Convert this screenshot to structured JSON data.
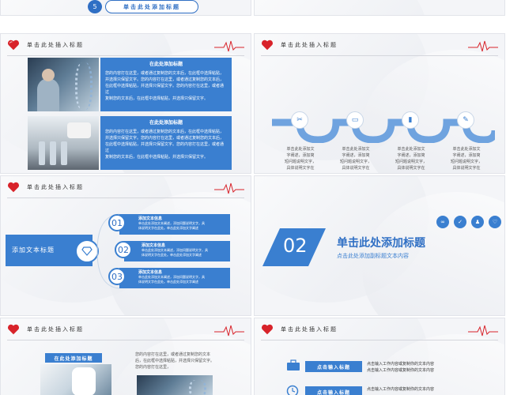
{
  "slide_top_left": {
    "number": "5",
    "title": "单击此处添加标题"
  },
  "header_title": "单击此处插入标题",
  "slide2": {
    "panel1_title": "在此处添加标题",
    "panel1_text": [
      "您的内容打在这里，或者通过复制您的文本后，在此框中选择粘贴，",
      "并选择只保留文字。您的内容打在这里，或者通过复制您的文本后，",
      "在此框中选择粘贴，并选择只保留文字。您的内容打在这里，或者通过",
      "复制您的文本后，在此框中选择粘贴，并选择只保留文字。"
    ],
    "panel2_title": "在此处添加标题",
    "panel2_text": [
      "您的内容打在这里，或者通过复制您的文本后，在此框中选择粘贴，",
      "并选择只保留文字。您的内容打在这里，或者通过复制您的文本后，",
      "在此框中选择粘贴，并选择只保留文字。您的内容打在这里，或者通过",
      "复制您的文本后，在此框中选择粘贴，并选择只保留文字。"
    ]
  },
  "slide3": {
    "items": [
      {
        "icon": "tools-icon",
        "glyph": "✂",
        "lines": [
          "单击此处添加文",
          "字阐述，添加简",
          "短问题说明文字，",
          "具体说明文字在",
          "此处。"
        ]
      },
      {
        "icon": "laptop-icon",
        "glyph": "▭",
        "lines": [
          "单击此处添加文",
          "字阐述，添加简",
          "短问题说明文字，",
          "具体说明文字在",
          "此处，单击此处"
        ]
      },
      {
        "icon": "chart-icon",
        "glyph": "▮",
        "lines": [
          "单击此处添加文",
          "字阐述，添加简",
          "短问题说明文字，",
          "具体说明文字在",
          "此处，单击此处"
        ]
      },
      {
        "icon": "tool-icon",
        "glyph": "✎",
        "lines": [
          "单击此处添加文",
          "字阐述，添加简",
          "短问题说明文字，",
          "具体说明文字在",
          "此处，单击此处"
        ]
      }
    ]
  },
  "slide4": {
    "left_label": "添加文本标题",
    "items": [
      {
        "num": "01",
        "title": "添加文本信息",
        "text": [
          "单击此处添加文本阐述，添加问题说明文字，具",
          "体说明文字在此处。单击此处添加文字阐述"
        ]
      },
      {
        "num": "02",
        "title": "添加文本信息",
        "text": [
          "单击此处添加文本阐述，添加问题说明文字，具",
          "体说明文字在此处。单击此处添加文字阐述"
        ]
      },
      {
        "num": "03",
        "title": "添加文本信息",
        "text": [
          "单击此处添加文本阐述，添加问题说明文字，具",
          "体说明文字在此处。单击此处添加文字阐述"
        ]
      }
    ]
  },
  "slide5": {
    "number": "02",
    "title": "单击此处添加标题",
    "subtitle": "点击此处添加副标题文本内容"
  },
  "slide6": {
    "panel_title": "在此处添加标题",
    "text": [
      "您的内容打在这里，或者通过复制您的文本",
      "后，在此框中选择粘贴，并选择只保留文字。",
      "您的内容打在这里，"
    ]
  },
  "slide7": {
    "rows": [
      {
        "label": "点击输入标题",
        "text": [
          "点击输入工作内容或复制你的文本内容",
          "点击输入工作内容或复制你的文本内容"
        ]
      },
      {
        "label": "点击输入标题",
        "text": [
          "点击输入工作内容或复制你的文本内容",
          "点击输入工作内容或复制你的文本内容"
        ]
      }
    ]
  },
  "colors": {
    "accent": "#3a7fd0",
    "accent_dark": "#2f6fc4",
    "heart": "#d8232a"
  }
}
